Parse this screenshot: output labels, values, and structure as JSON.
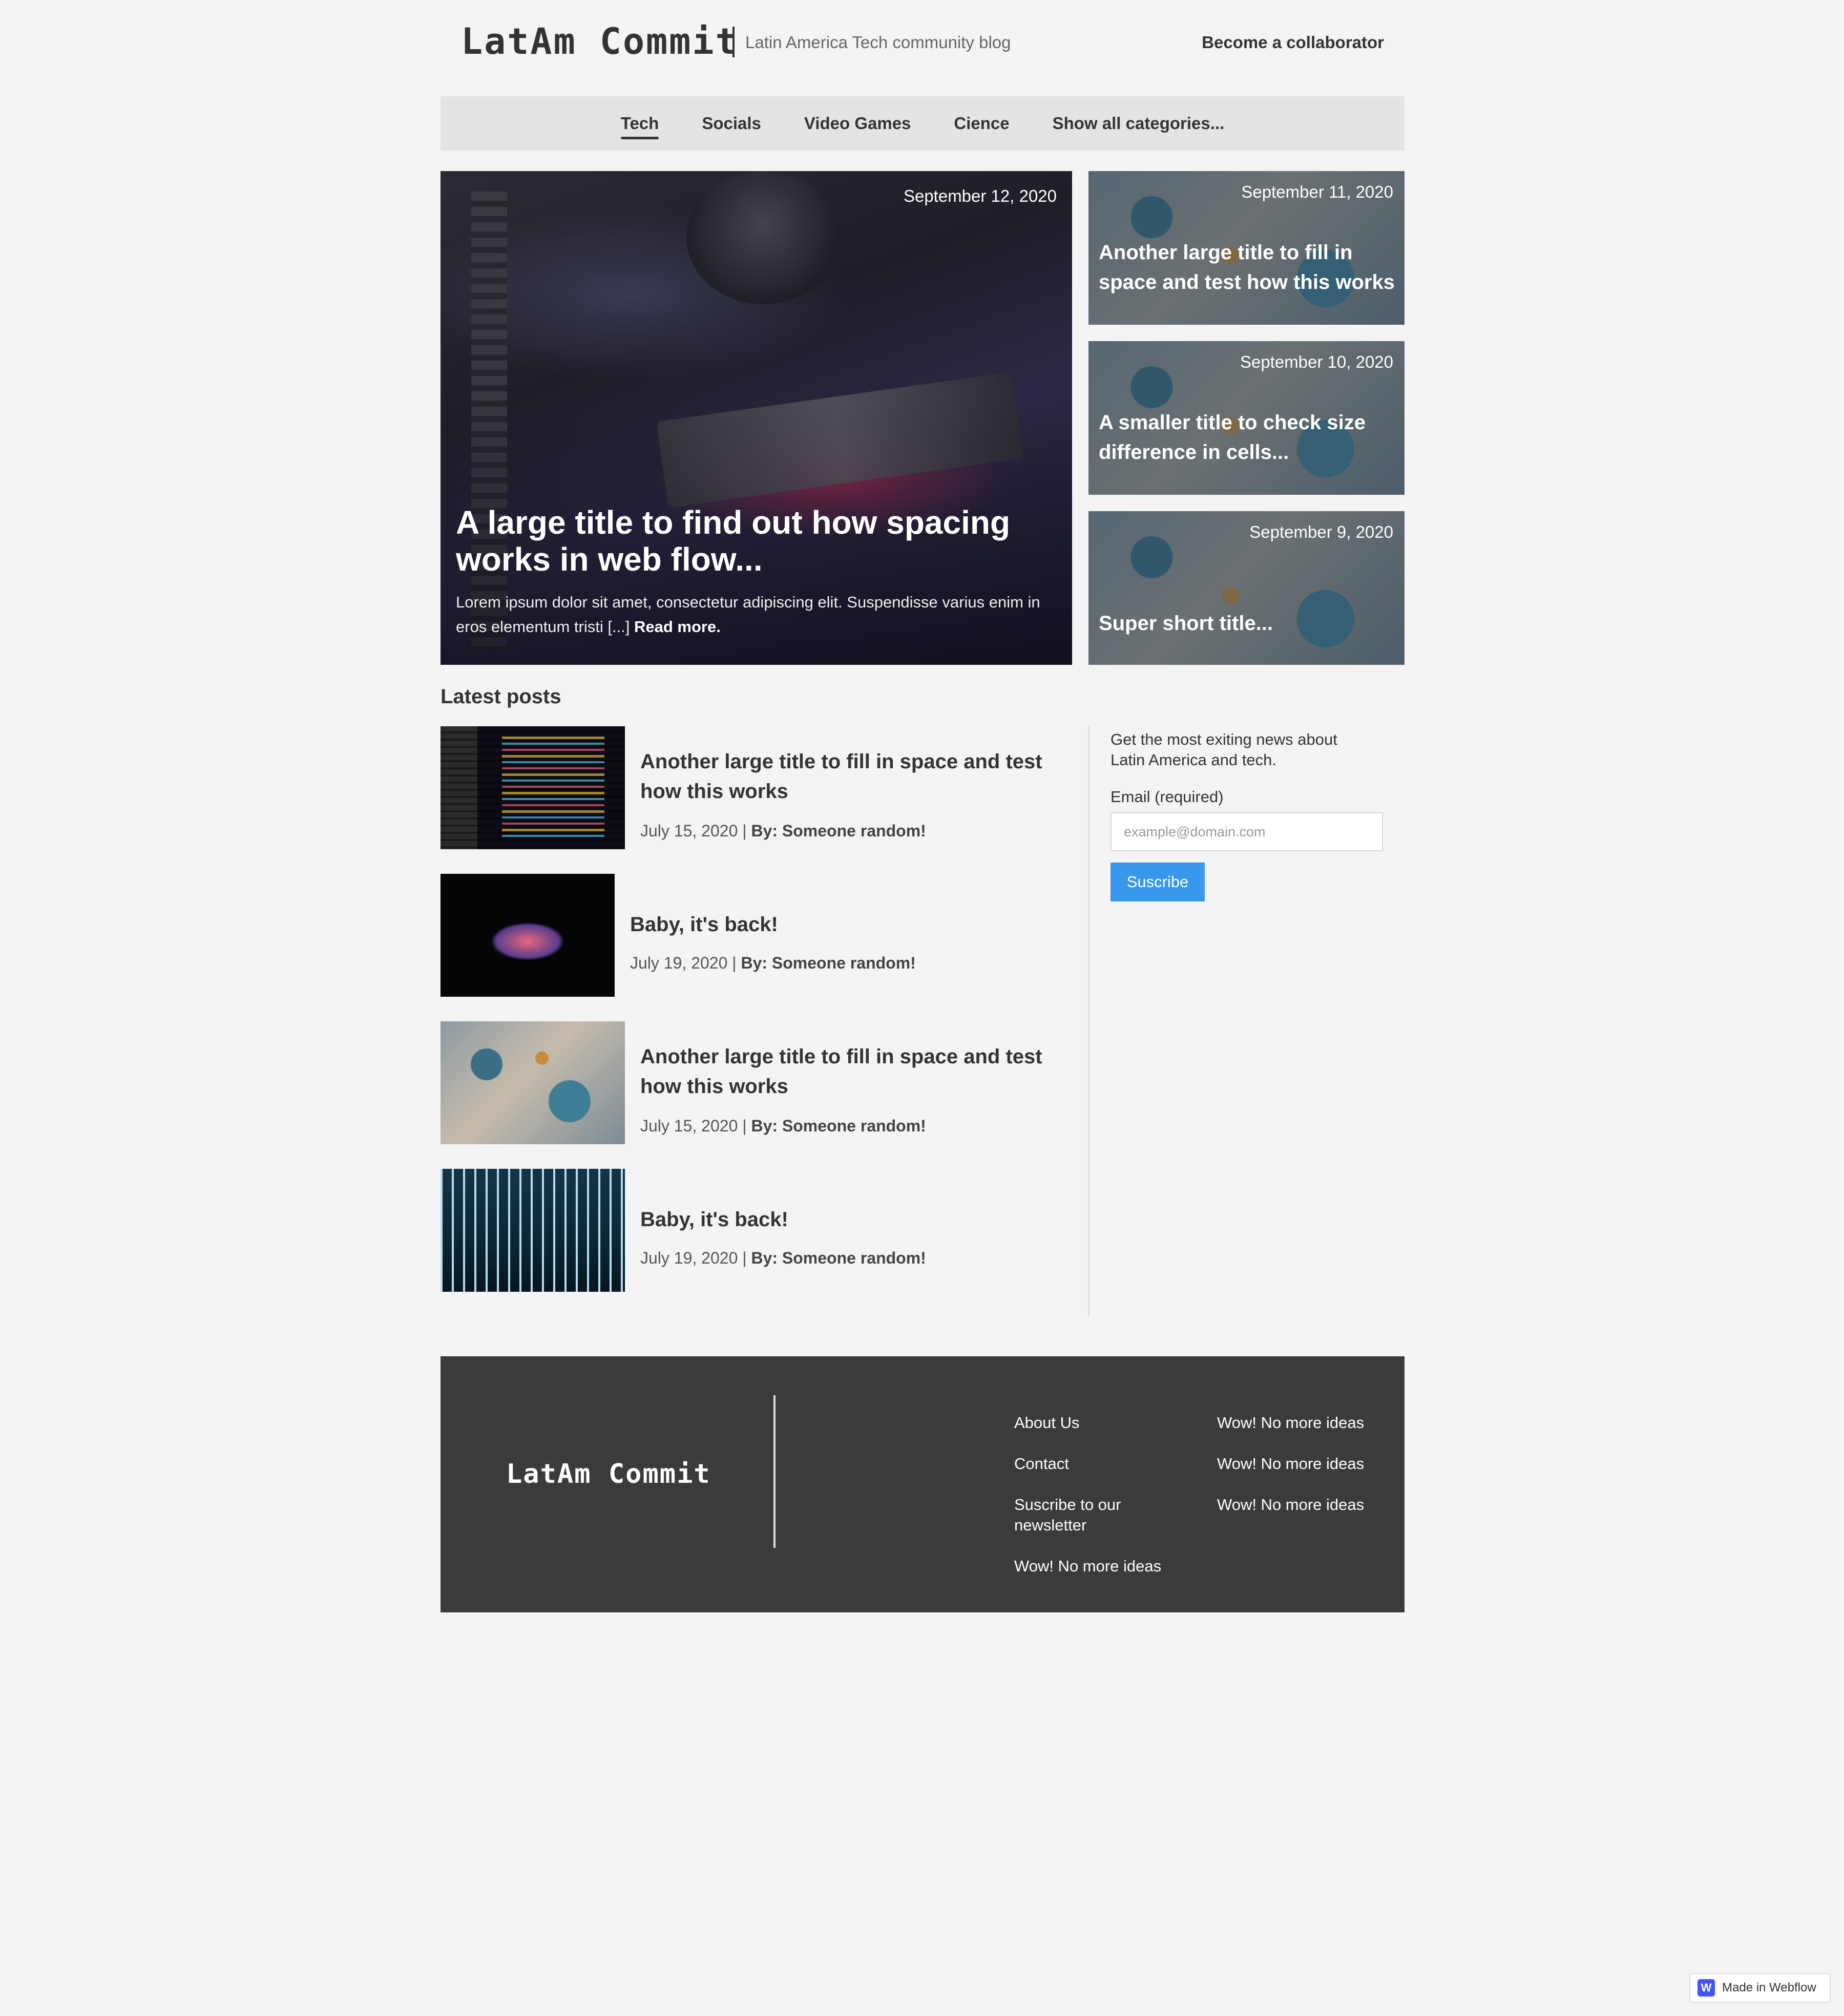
{
  "header": {
    "logo": "LatAm Commit",
    "tagline": "Latin America Tech community blog",
    "collab_link": "Become a collaborator"
  },
  "nav": {
    "items": [
      "Tech",
      "Socials",
      "Video Games",
      "Cience",
      "Show all categories..."
    ],
    "active": "Tech"
  },
  "featured": {
    "hero": {
      "date": "September 12, 2020",
      "title": "A large title to find out how spacing works in web flow...",
      "excerpt": "Lorem ipsum dolor sit amet, consectetur adipiscing elit. Suspendisse varius enim in eros elementum tristi [...]",
      "read_more": "Read more."
    },
    "side": [
      {
        "date": "September 11, 2020",
        "title": "Another large title to fill in space and test how this works"
      },
      {
        "date": "September 10, 2020",
        "title": "A smaller title to check size difference in cells..."
      },
      {
        "date": "September 9, 2020",
        "title": "Super short title..."
      }
    ]
  },
  "latest": {
    "heading": "Latest posts",
    "posts": [
      {
        "title": "Another large title to fill in space and test how this works",
        "date": "July 15, 2020 |",
        "by": "By: Someone random!"
      },
      {
        "title": "Baby, it's back!",
        "date": "July 19, 2020 |",
        "by": "By: Someone random!"
      },
      {
        "title": "Another large title to fill in space and test how this works",
        "date": "July 15, 2020 |",
        "by": "By: Someone random!"
      },
      {
        "title": "Baby, it's back!",
        "date": "July 19, 2020 |",
        "by": "By: Someone random!"
      }
    ]
  },
  "newsletter": {
    "blurb": "Get the most exiting news about Latin America and tech.",
    "label": "Email (required)",
    "placeholder": "example@domain.com",
    "button": "Suscribe",
    "button_color": "#3898ec"
  },
  "footer": {
    "logo": "LatAm Commit",
    "col1": [
      "About Us",
      "Contact",
      "Suscribe to our newsletter",
      "Wow! No more ideas"
    ],
    "col2": [
      "Wow! No more ideas",
      "Wow! No more ideas",
      "Wow! No more ideas"
    ],
    "background": "#3b3b3b"
  },
  "badge": {
    "icon": "W",
    "text": "Made in Webflow"
  }
}
